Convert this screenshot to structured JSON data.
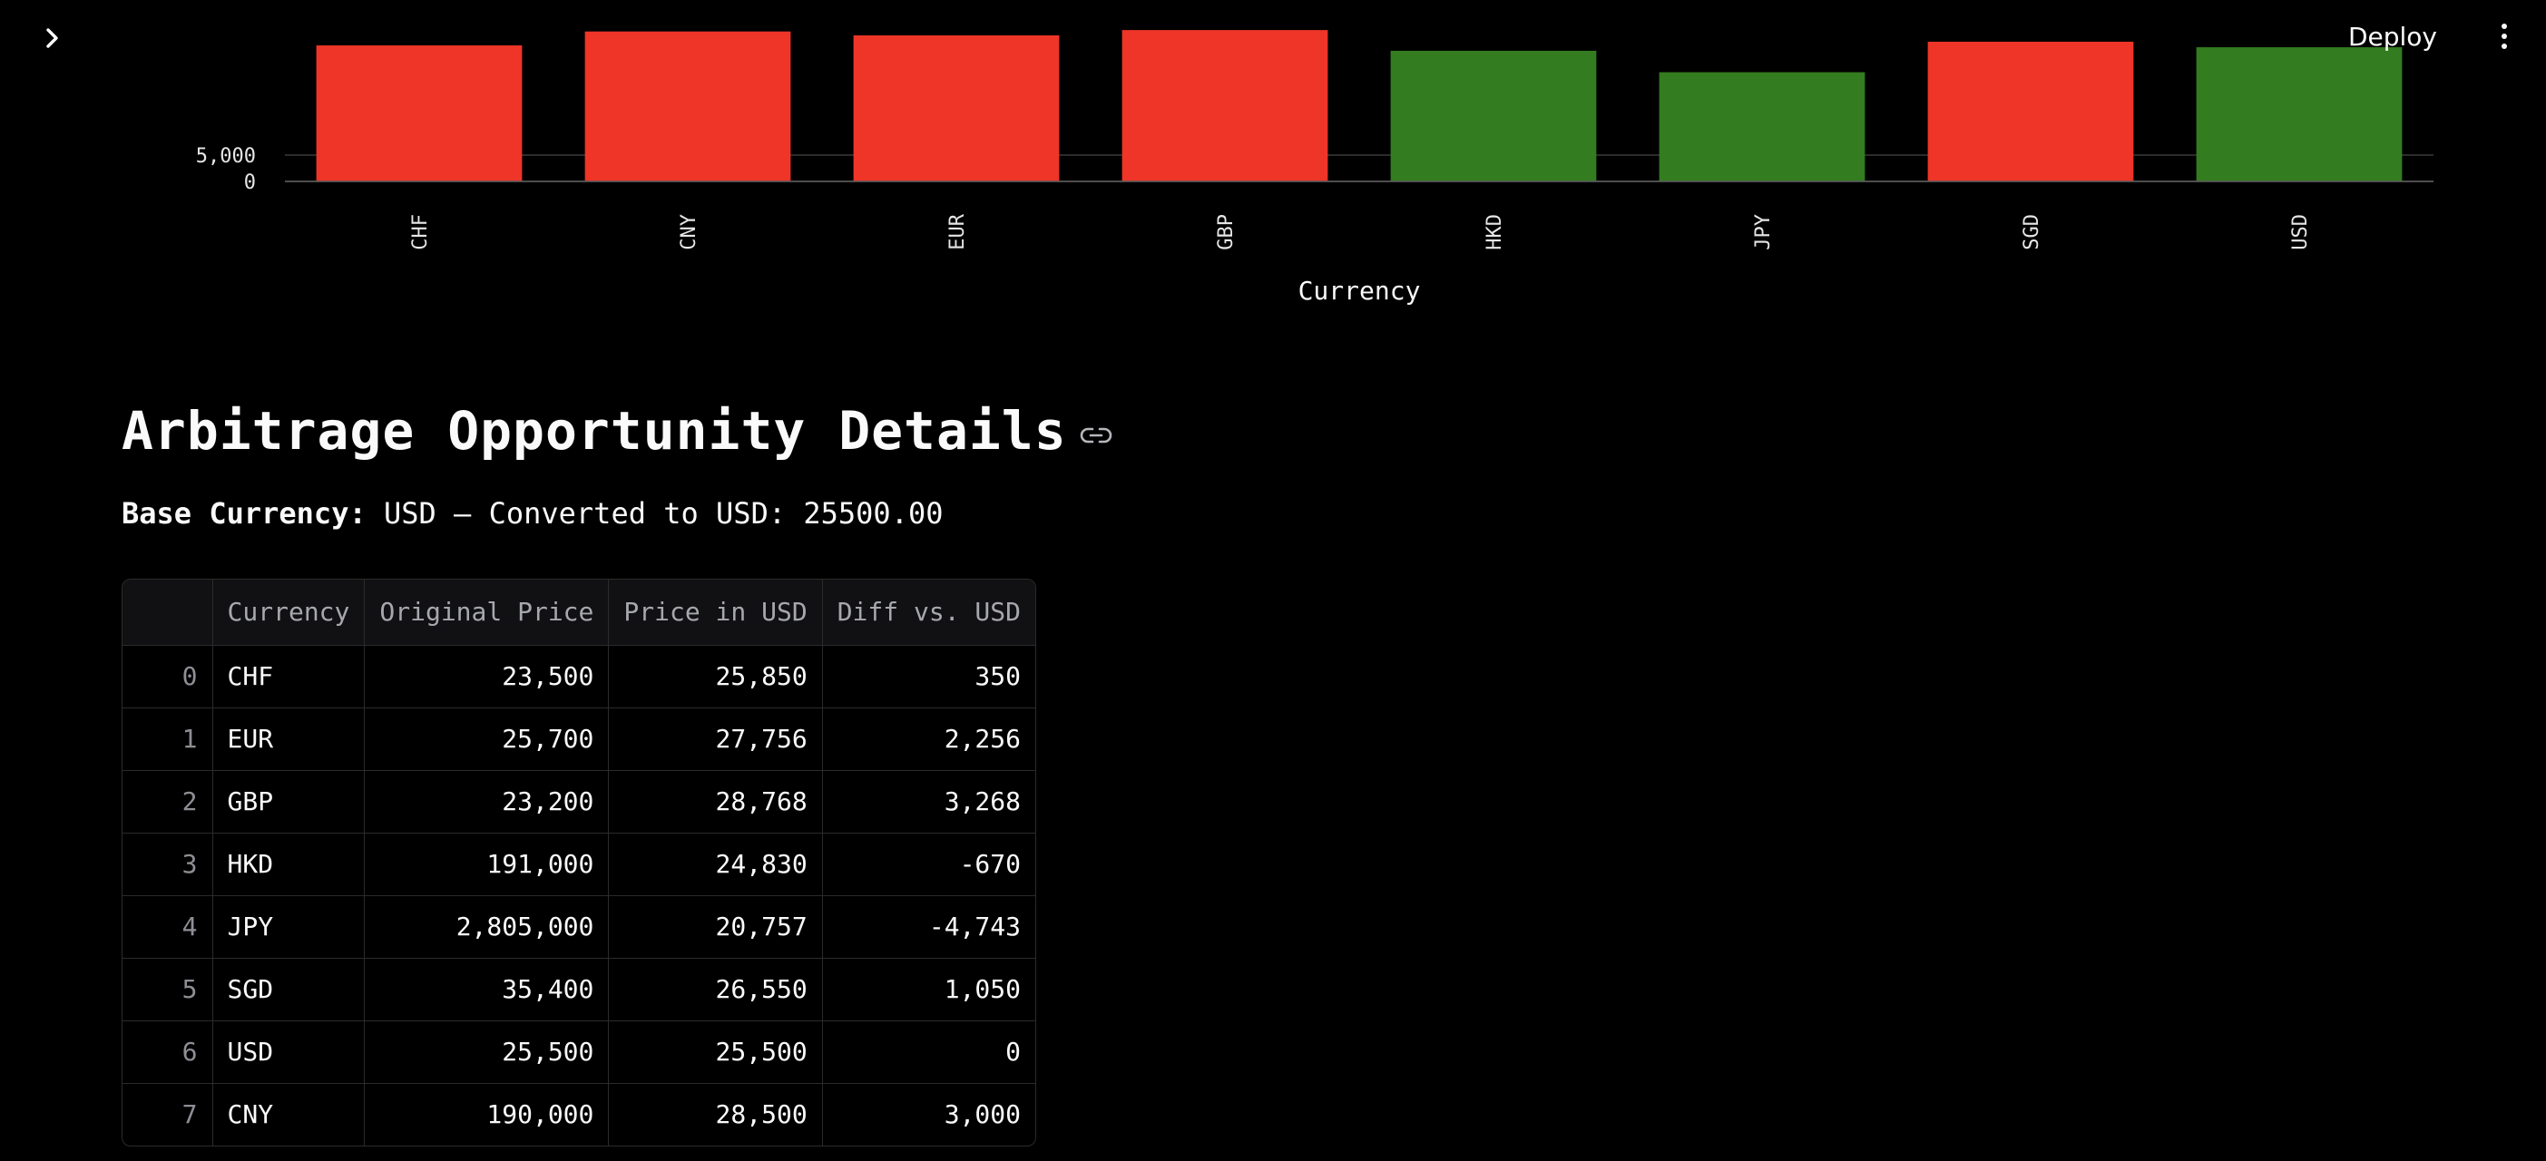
{
  "header": {
    "deploy_label": "Deploy",
    "sidebar_toggle_icon": "chevron-right-icon",
    "menu_icon": "vertical-dots-icon"
  },
  "chart_data": {
    "type": "bar",
    "categories": [
      "CHF",
      "CNY",
      "EUR",
      "GBP",
      "HKD",
      "JPY",
      "SGD",
      "USD"
    ],
    "values": [
      25850,
      28500,
      27756,
      28768,
      24830,
      20757,
      26550,
      25500
    ],
    "colors": [
      "#ee3528",
      "#ee3528",
      "#ee3528",
      "#ee3528",
      "#337c20",
      "#337c20",
      "#ee3528",
      "#337c20"
    ],
    "xlabel": "Currency",
    "ytick_labels": [
      "5,000",
      "0"
    ],
    "ytick_values": [
      5000,
      0
    ],
    "grid": true,
    "colors_meaning": {
      "above": "#ee3528",
      "at_or_below": "#337c20"
    }
  },
  "section": {
    "title": "Arbitrage Opportunity Details",
    "link_icon": "link-icon",
    "base_label": "Base Currency:",
    "base_value": " USD — Converted to USD: 25500.00"
  },
  "table": {
    "columns": [
      "",
      "Currency",
      "Original Price",
      "Price in USD",
      "Diff vs. USD"
    ],
    "rows": [
      [
        "0",
        "CHF",
        "23,500",
        "25,850",
        "350"
      ],
      [
        "1",
        "EUR",
        "25,700",
        "27,756",
        "2,256"
      ],
      [
        "2",
        "GBP",
        "23,200",
        "28,768",
        "3,268"
      ],
      [
        "3",
        "HKD",
        "191,000",
        "24,830",
        "-670"
      ],
      [
        "4",
        "JPY",
        "2,805,000",
        "20,757",
        "-4,743"
      ],
      [
        "5",
        "SGD",
        "35,400",
        "26,550",
        "1,050"
      ],
      [
        "6",
        "USD",
        "25,500",
        "25,500",
        "0"
      ],
      [
        "7",
        "CNY",
        "190,000",
        "28,500",
        "3,000"
      ]
    ]
  }
}
